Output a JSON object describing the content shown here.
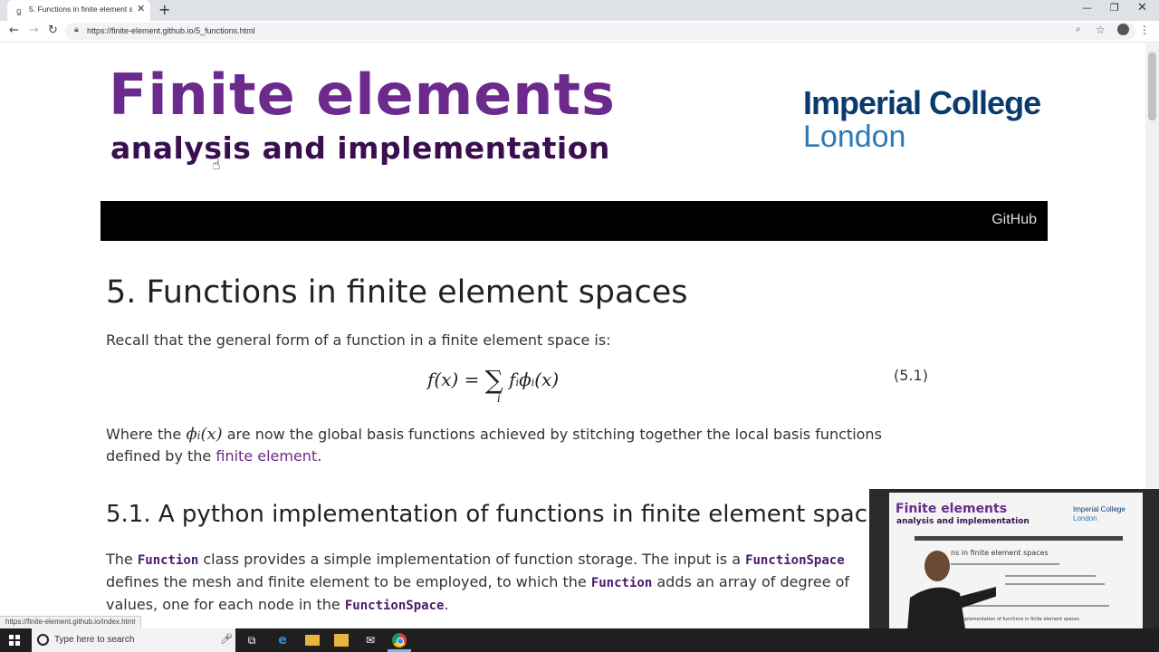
{
  "browser": {
    "tab_title": "5. Functions in finite element spa",
    "url": "https://finite-element.github.io/5_functions.html",
    "status_url": "https://finite-element.github.io/index.html"
  },
  "header": {
    "logo_title": "Finite elements",
    "logo_subtitle": "analysis and implementation",
    "college_line1": "Imperial College",
    "college_line2": "London",
    "nav_link": "GitHub"
  },
  "content": {
    "heading": "5. Functions in finite element spaces",
    "intro": "Recall that the general form of a function in a finite element space is:",
    "equation_number": "(5.1)",
    "where_prefix": "Where the ",
    "where_suffix": " are now the global basis functions achieved by stitching together the local basis functions",
    "where_line2_prefix": "defined by the ",
    "where_link": "finite element",
    "where_line2_suffix": ".",
    "subheading": "5.1. A python implementation of functions in finite element spac",
    "fn_line1_a": "The ",
    "fn_code_function": "Function",
    "fn_line1_b": " class provides a simple implementation of function storage. The input is a ",
    "fn_code_functionspace": "FunctionSpace",
    "fn_line2_a": "defines the mesh and finite element to be employed, to which the ",
    "fn_line2_b": " adds an array of degree of",
    "fn_line3_a": "values, one for each node in the ",
    "fn_line3_b": "."
  },
  "video": {
    "title": "Finite elements",
    "subtitle": "analysis and implementation",
    "logo_line1": "Imperial College",
    "logo_line2": "London",
    "heading": "ns in finite element spaces",
    "heading2": "n implementation of functions in finite element spaces"
  },
  "taskbar": {
    "search_placeholder": "Type here to search"
  },
  "colors": {
    "brand_purple": "#6b2a8c",
    "imperial_navy": "#0a3a6e",
    "imperial_blue": "#2a7ab8"
  }
}
